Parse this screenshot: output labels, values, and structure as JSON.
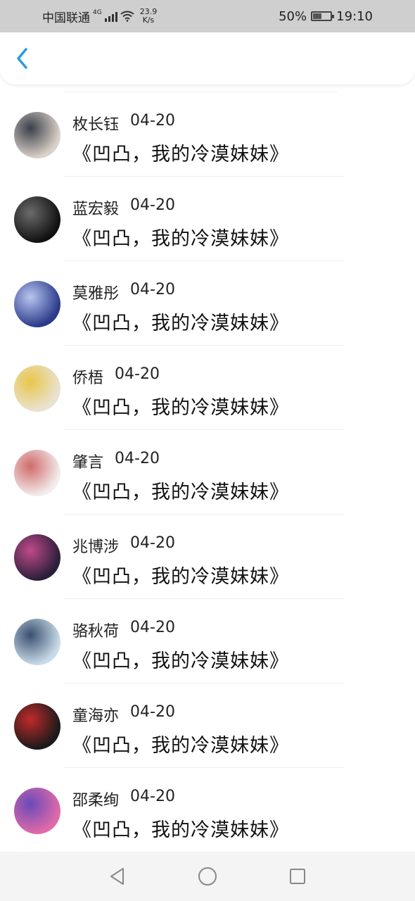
{
  "status_bar": {
    "carrier": "中国联通",
    "network": "4G",
    "speed_value": "23.9",
    "speed_unit": "K/s",
    "battery_percent": "50%",
    "battery_level": 0.5,
    "time": "19:10"
  },
  "header": {
    "back_icon": "chevron-left-icon",
    "accent": "#2a9be0"
  },
  "items": [
    {
      "name": "枚长钰",
      "date": "04-20",
      "title": "《凹凸，我的冷漠妹妹》",
      "avatar_colors": [
        "#d9d0c8",
        "#3a3f4a"
      ]
    },
    {
      "name": "蓝宏毅",
      "date": "04-20",
      "title": "《凹凸，我的冷漠妹妹》",
      "avatar_colors": [
        "#111111",
        "#6b6b6b"
      ]
    },
    {
      "name": "莫雅彤",
      "date": "04-20",
      "title": "《凹凸，我的冷漠妹妹》",
      "avatar_colors": [
        "#2b3a8a",
        "#b8c6f0"
      ]
    },
    {
      "name": "侨梧",
      "date": "04-20",
      "title": "《凹凸，我的冷漠妹妹》",
      "avatar_colors": [
        "#e9e2d2",
        "#e8c64a"
      ]
    },
    {
      "name": "肇言",
      "date": "04-20",
      "title": "《凹凸，我的冷漠妹妹》",
      "avatar_colors": [
        "#f2ecec",
        "#d06a6a"
      ]
    },
    {
      "name": "兆博涉",
      "date": "04-20",
      "title": "《凹凸，我的冷漠妹妹》",
      "avatar_colors": [
        "#2a1f3a",
        "#c04a8a"
      ]
    },
    {
      "name": "骆秋荷",
      "date": "04-20",
      "title": "《凹凸，我的冷漠妹妹》",
      "avatar_colors": [
        "#c9dbe8",
        "#3a5070"
      ]
    },
    {
      "name": "童海亦",
      "date": "04-20",
      "title": "《凹凸，我的冷漠妹妹》",
      "avatar_colors": [
        "#1a1a1a",
        "#c02a2a"
      ]
    },
    {
      "name": "邵柔绚",
      "date": "04-20",
      "title": "《凹凸，我的冷漠妹妹》",
      "avatar_colors": [
        "#e06aa8",
        "#6a4ab8"
      ]
    }
  ],
  "nav_bar": {
    "back_icon": "triangle-back-icon",
    "home_icon": "circle-home-icon",
    "recents_icon": "square-recents-icon"
  }
}
